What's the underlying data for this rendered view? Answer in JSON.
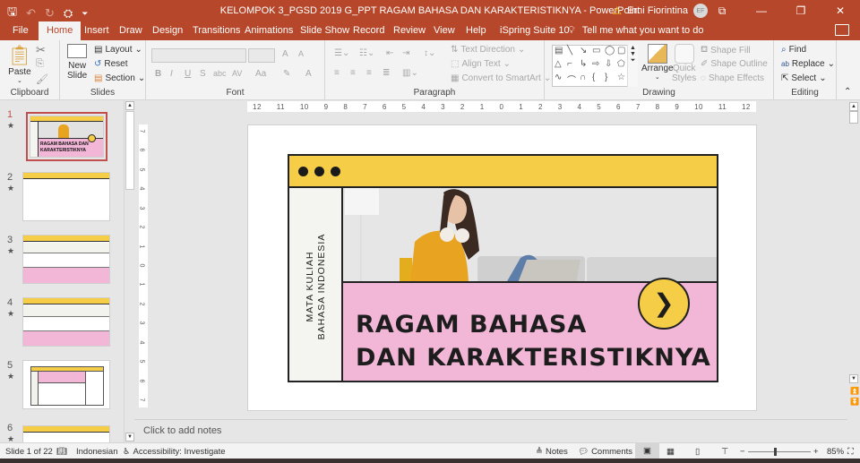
{
  "app": {
    "document_title": "KELOMPOK 3_PGSD 2019 G_PPT RAGAM BAHASA DAN KARAKTERISTIKNYA",
    "app_name": "PowerPoint",
    "title_separator": "-",
    "user_name": "Erni Fiorintina",
    "user_initials": "EF",
    "warning_icon": "warning-icon"
  },
  "quick_access": [
    "save-icon",
    "undo-icon",
    "redo-icon",
    "present-icon",
    "customize-icon"
  ],
  "tabs": [
    {
      "label": "File",
      "active": false
    },
    {
      "label": "Home",
      "active": true
    },
    {
      "label": "Insert",
      "active": false
    },
    {
      "label": "Draw",
      "active": false
    },
    {
      "label": "Design",
      "active": false
    },
    {
      "label": "Transitions",
      "active": false
    },
    {
      "label": "Animations",
      "active": false
    },
    {
      "label": "Slide Show",
      "active": false
    },
    {
      "label": "Record",
      "active": false
    },
    {
      "label": "Review",
      "active": false
    },
    {
      "label": "View",
      "active": false
    },
    {
      "label": "Help",
      "active": false
    },
    {
      "label": "iSpring Suite 10",
      "active": false
    }
  ],
  "tell_me": "Tell me what you want to do",
  "ribbon": {
    "clipboard": {
      "label": "Clipboard",
      "paste": "Paste"
    },
    "slides": {
      "label": "Slides",
      "new_slide_1": "New",
      "new_slide_2": "Slide",
      "layout": "Layout",
      "reset": "Reset",
      "section": "Section"
    },
    "font": {
      "label": "Font",
      "bold": "B",
      "italic": "I",
      "underline": "U",
      "shadow": "S",
      "strike": "abc",
      "spacing": "AV",
      "case": "Aa",
      "grow": "A",
      "shrink": "A",
      "color": "A"
    },
    "paragraph": {
      "label": "Paragraph",
      "text_direction": "Text Direction",
      "align_text": "Align Text",
      "convert_smartart": "Convert to SmartArt"
    },
    "drawing": {
      "label": "Drawing",
      "arrange": "Arrange",
      "quick_styles_1": "Quick",
      "quick_styles_2": "Styles",
      "shape_fill": "Shape Fill",
      "shape_outline": "Shape Outline",
      "shape_effects": "Shape Effects",
      "shapes": [
        "▤",
        "╲",
        "↘",
        "▭",
        "◯",
        "▢",
        "△",
        "⌐",
        "↳",
        "⇨",
        "⇩",
        "⬠",
        "∿",
        "⌒",
        "∩",
        "{",
        "}",
        "☆"
      ]
    },
    "editing": {
      "label": "Editing",
      "find": "Find",
      "replace": "Replace",
      "select": "Select"
    }
  },
  "slide_panel": {
    "slides": [
      {
        "number": "1",
        "selected": true
      },
      {
        "number": "2",
        "selected": false
      },
      {
        "number": "3",
        "selected": false
      },
      {
        "number": "4",
        "selected": false
      },
      {
        "number": "5",
        "selected": false
      },
      {
        "number": "6",
        "selected": false
      }
    ],
    "thumb1_title": "RAGAM BAHASA DAN KARAKTERISTIKNYA"
  },
  "ruler": {
    "horizontal": [
      "12",
      "11",
      "10",
      "9",
      "8",
      "7",
      "6",
      "5",
      "4",
      "3",
      "2",
      "1",
      "0",
      "1",
      "2",
      "3",
      "4",
      "5",
      "6",
      "7",
      "8",
      "9",
      "10",
      "11",
      "12"
    ],
    "vertical": [
      "7",
      "6",
      "5",
      "4",
      "3",
      "2",
      "1",
      "0",
      "1",
      "2",
      "3",
      "4",
      "5",
      "6",
      "7"
    ]
  },
  "slide": {
    "vertical_text_line1": "MATA KULIAH",
    "vertical_text_line2": "BAHASA INDONESIA",
    "title_line1": "RAGAM BAHASA",
    "title_line2": "DAN KARAKTERISTIKNYA",
    "colors": {
      "yellow": "#f6cd47",
      "pink": "#f2b6d6",
      "dark": "#1d1d1d",
      "offwhite": "#f4f4f0"
    }
  },
  "notes_placeholder": "Click to add notes",
  "status": {
    "slide_info": "Slide 1 of 22",
    "language": "Indonesian",
    "accessibility": "Accessibility: Investigate",
    "notes": "Notes",
    "comments": "Comments",
    "zoom_minus": "−",
    "zoom_plus": "+",
    "zoom_level": "85%",
    "zoom_percent": 85
  }
}
